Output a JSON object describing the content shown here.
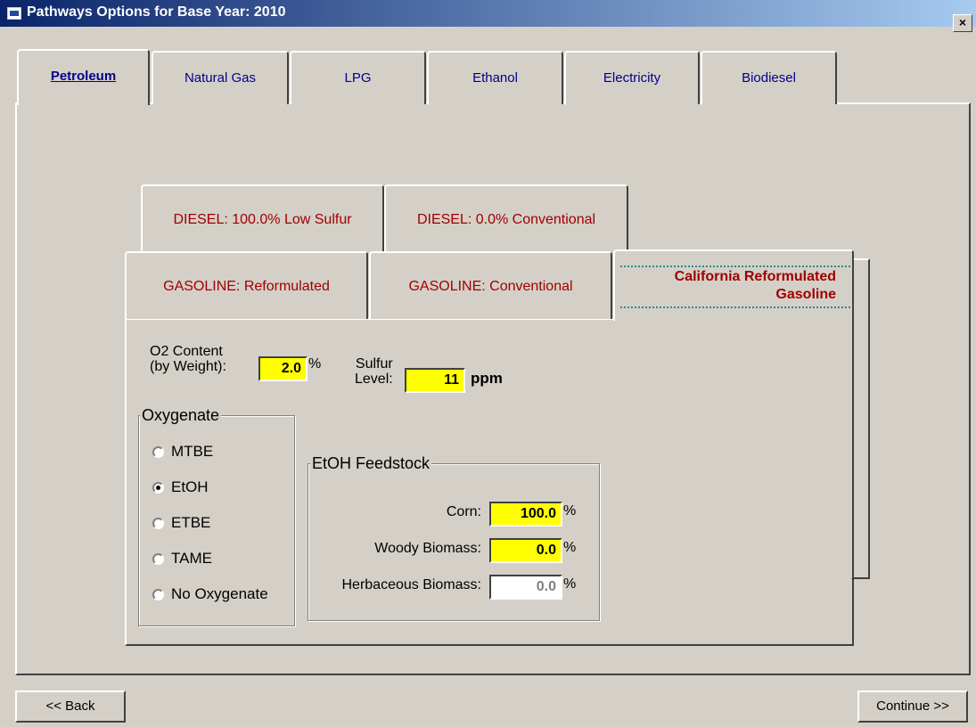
{
  "window": {
    "title": "Pathways Options for Base Year: 2010",
    "close_glyph": "×"
  },
  "main_tabs": [
    {
      "label": "Petroleum",
      "active": true
    },
    {
      "label": "Natural Gas",
      "active": false
    },
    {
      "label": "LPG",
      "active": false
    },
    {
      "label": "Ethanol",
      "active": false
    },
    {
      "label": "Electricity",
      "active": false
    },
    {
      "label": "Biodiesel",
      "active": false
    }
  ],
  "sub_tabs": {
    "back_row": [
      "DIESEL: 100.0% Low Sulfur",
      "DIESEL: 0.0% Conventional"
    ],
    "front_row": [
      "GASOLINE: Reformulated",
      "GASOLINE: Conventional",
      "California Reformulated Gasoline"
    ],
    "active": "California Reformulated Gasoline"
  },
  "o2": {
    "label": "O2 Content (by Weight):",
    "label_line1": "O2 Content",
    "label_line2": "(by Weight):",
    "value": "2.0",
    "unit": "%"
  },
  "sulfur": {
    "label_line1": "Sulfur",
    "label_line2": "Level:",
    "value": "11",
    "unit": "ppm"
  },
  "oxygenate": {
    "title": "Oxygenate",
    "options": [
      "MTBE",
      "EtOH",
      "ETBE",
      "TAME",
      "No Oxygenate"
    ],
    "selected": "EtOH"
  },
  "feedstock": {
    "title": "EtOH Feedstock",
    "rows": [
      {
        "label": "Corn:",
        "value": "100.0",
        "unit": "%",
        "enabled": true
      },
      {
        "label": "Woody Biomass:",
        "value": "0.0",
        "unit": "%",
        "enabled": true
      },
      {
        "label": "Herbaceous Biomass:",
        "value": "0.0",
        "unit": "%",
        "enabled": false
      }
    ]
  },
  "buttons": {
    "back": "<< Back",
    "continue": "Continue >>"
  },
  "colors": {
    "input_highlight": "#ffff00",
    "subtab_text": "#a00000",
    "main_tab_text": "#00008b",
    "titlebar": "#0a246a"
  }
}
